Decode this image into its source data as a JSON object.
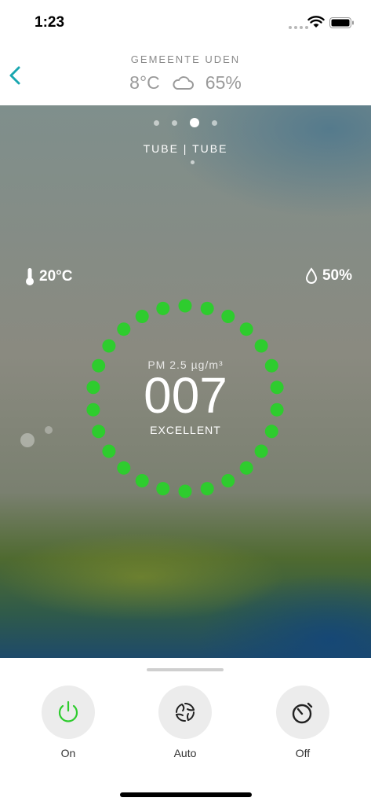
{
  "status_bar": {
    "time": "1:23"
  },
  "header": {
    "location": "GEMEENTE UDEN",
    "outdoor_temp": "8°C",
    "outdoor_humidity": "65%",
    "weather_icon": "cloud-icon"
  },
  "pager": {
    "count": 4,
    "active_index": 2
  },
  "device": {
    "name": "TUBE | TUBE"
  },
  "indoor": {
    "temperature": "20°C",
    "humidity": "50%"
  },
  "air_quality": {
    "label": "PM 2.5 µg/m³",
    "value": "007",
    "status": "EXCELLENT",
    "ring_color": "#2ecc2e"
  },
  "controls": [
    {
      "label": "On",
      "icon": "power-icon",
      "color": "#2ecc2e"
    },
    {
      "label": "Auto",
      "icon": "fan-icon",
      "color": "#222222"
    },
    {
      "label": "Off",
      "icon": "timer-icon",
      "color": "#222222"
    }
  ]
}
